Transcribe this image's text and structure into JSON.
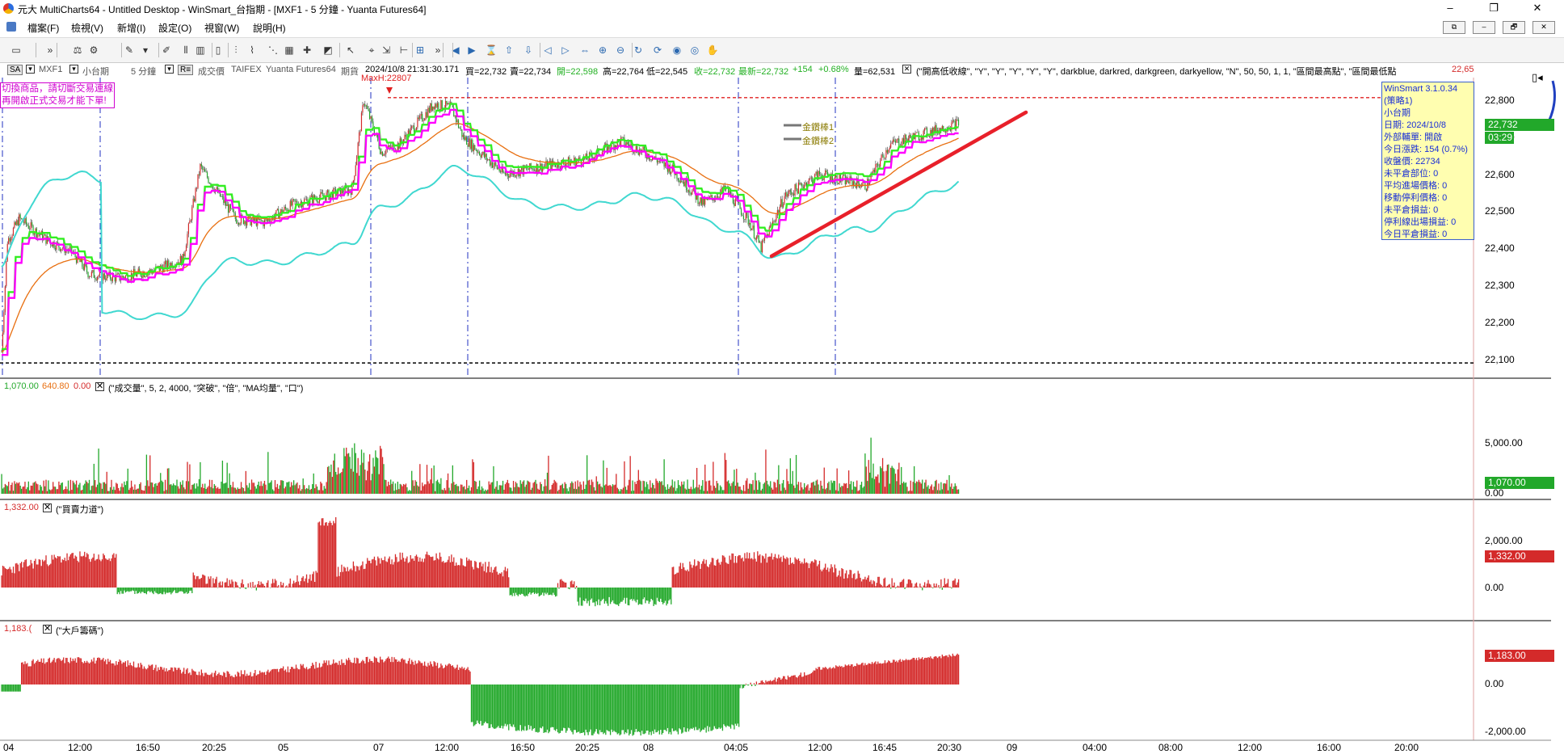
{
  "window": {
    "title": "元大 MultiCharts64 - Untitled Desktop - WinSmart_台指期 - [MXF1 - 5 分鐘 - Yuanta Futures64]",
    "controls": [
      "–",
      "❐",
      "✕"
    ],
    "mdi_controls": [
      "⧉",
      "–",
      "🗗",
      "✕"
    ]
  },
  "menu": [
    "檔案(F)",
    "檢視(V)",
    "新增(I)",
    "設定(O)",
    "視窗(W)",
    "說明(H)"
  ],
  "toolbar_icons": [
    "chart-window-icon",
    "more-icon",
    "indicator-icon",
    "strategy-icon",
    "drawing-tool-icon",
    "dropdown-icon",
    "pen-icon",
    "bar-type-icon",
    "candlestick-icon",
    "hollow-candle-icon",
    "ohlc-icon",
    "line-icon",
    "dot-icon",
    "histogram-icon",
    "cross-icon",
    "area-icon",
    "pointer-icon",
    "crosshair-icon",
    "cursor-move-icon",
    "measure-icon",
    "zoom-area-icon",
    "more-icon",
    "play-back-icon",
    "play-icon",
    "hourglass-icon",
    "arrow-up-icon",
    "arrow-down-icon",
    "scroll-left-icon",
    "scroll-right-icon",
    "scroll-both-icon",
    "zoom-in-icon",
    "zoom-out-icon",
    "refresh-icon",
    "refresh-all-icon",
    "eye-icon",
    "eye-off-icon",
    "hand-icon"
  ],
  "info_bar": {
    "symbol_tag": "SA",
    "symbol": "MXF1",
    "name": "小台期",
    "interval": "5 分鐘",
    "field": "成交價",
    "exchange": "TAIFEX",
    "feed": "Yuanta Futures64",
    "type": "期貨",
    "datetime": "2024/10/8  21:31:30.171",
    "bid": "買=22,732",
    "ask": "賣=22,734",
    "open": "開=22,598",
    "high": "高=22,764",
    "low": "低=22,545",
    "close": "收=22,732",
    "last": "最新=22,732",
    "change": "+154",
    "change_pct": "+0.68%",
    "volume": "量=62,531",
    "study": "(\"開高低收線\", \"Y\", \"Y\", \"Y\", \"Y\", \"Y\", darkblue, darkred, darkgreen, darkyellow, \"N\", 50, 50, 1, 1, \"區間最高點\", \"區間最低點",
    "study_value": "22,65"
  },
  "warning": [
    "切換商品，請切斷交易連線",
    "再開啟正式交易才能下單!"
  ],
  "max_marker": "MaxH:22807",
  "gold_labels": [
    "金鑽棒1",
    "金鑽棒2"
  ],
  "info_box": [
    "WinSmart 3.1.0.34",
    "(策略1)",
    "小台期",
    "日期: 2024/10/8",
    "外部輔單: 開啟",
    "今日漲跌: 154 (0.7%)",
    "收盤價: 22734",
    "未平倉部位: 0",
    "平均進場價格: 0",
    "移動停利價格: 0",
    "未平倉損益: 0",
    "停利線出場損益: 0",
    "今日平倉損益: 0"
  ],
  "price_axis": [
    "22,800",
    "22,700",
    "22,600",
    "22,500",
    "22,400",
    "22,300",
    "22,200",
    "22,100"
  ],
  "price_badge": "22,732",
  "time_badge": "03:29",
  "volume_pane": {
    "values": [
      "1,070.00",
      "640.80",
      "0.00"
    ],
    "study": "(\"成交量\", 5, 2, 4000, \"突破\", \"倍\", \"MA均量\", \"口\")",
    "axis": [
      "5,000.00",
      "0.00"
    ],
    "badge": "1,070.00"
  },
  "force_pane": {
    "value": "1,332.00",
    "study": "(\"買賣力道\")",
    "axis": [
      "2,000.00",
      "0.00"
    ],
    "badge": "1,332.00"
  },
  "big_pane": {
    "value": "1,183.(",
    "study": "(\"大戶籌碼\")",
    "axis": [
      "0.00",
      "-2,000.00"
    ],
    "badge": "1,183.00"
  },
  "time_axis": [
    "04",
    "12:00",
    "16:50",
    "20:25",
    "05",
    "07",
    "12:00",
    "16:50",
    "20:25",
    "08",
    "04:05",
    "12:00",
    "16:45",
    "20:30",
    "09",
    "04:00",
    "08:00",
    "12:00",
    "16:00",
    "20:00"
  ],
  "colors": {
    "up": "#d42a2a",
    "down": "#22a82a",
    "cyan": "#40d8d0",
    "magenta": "#ff00ff",
    "lime": "#33ee22",
    "orange": "#e86f10",
    "trend": "#e8202a"
  }
}
